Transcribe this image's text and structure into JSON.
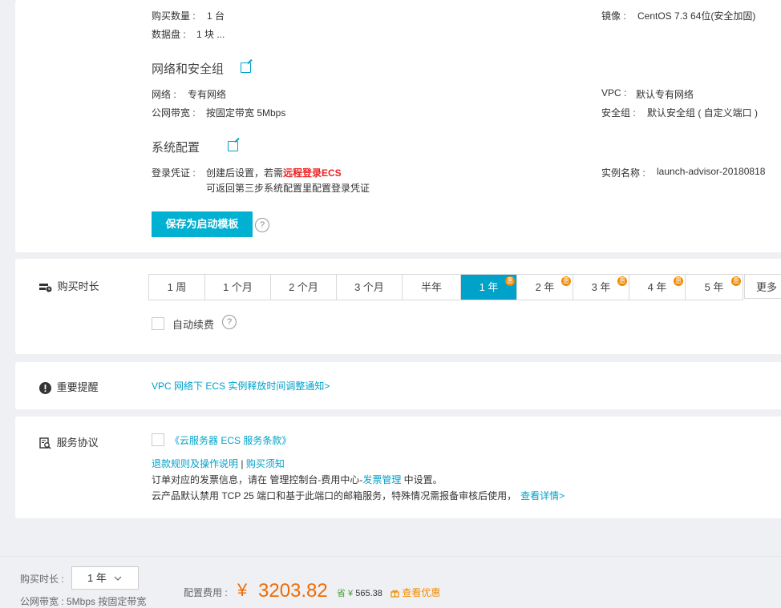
{
  "summary": {
    "purchase_qty_label": "购买数量 :",
    "purchase_qty_value": "1 台",
    "data_disk_label": "数据盘 :",
    "data_disk_value": "1 块 ...",
    "image_label": "镜像 :",
    "image_value": "CentOS 7.3 64位(安全加固)",
    "network_title": "网络和安全组",
    "network_label": "网络 :",
    "network_value": "专有网络",
    "bandwidth_label": "公网带宽 :",
    "bandwidth_value": "按固定带宽 5Mbps",
    "vpc_label": "VPC :",
    "vpc_value": "默认专有网络",
    "secgroup_label": "安全组 :",
    "secgroup_value": "默认安全组 ( 自定义端口 )",
    "system_title": "系统配置",
    "login_label": "登录凭证 :",
    "login_value_prefix": "创建后设置，若需",
    "login_value_link": "远程登录ECS",
    "login_value_line2": "可返回第三步系统配置里配置登录凭证",
    "instance_name_label": "实例名称 :",
    "instance_name_value": "launch-advisor-20180818",
    "save_template_label": "保存为启动模板",
    "help_glyph": "?"
  },
  "duration": {
    "label": "购买时长",
    "options": [
      {
        "label": "1 周",
        "discount": false,
        "active": false
      },
      {
        "label": "1 个月",
        "discount": false,
        "active": false
      },
      {
        "label": "2 个月",
        "discount": false,
        "active": false
      },
      {
        "label": "3 个月",
        "discount": false,
        "active": false
      },
      {
        "label": "半年",
        "discount": false,
        "active": false
      },
      {
        "label": "1 年",
        "discount": true,
        "active": true
      },
      {
        "label": "2 年",
        "discount": true,
        "active": false
      },
      {
        "label": "3 年",
        "discount": true,
        "active": false
      },
      {
        "label": "4 年",
        "discount": true,
        "active": false
      },
      {
        "label": "5 年",
        "discount": true,
        "active": false
      }
    ],
    "more_label": "更多",
    "auto_renew_label": "自动续费",
    "badge_glyph": "惠"
  },
  "notice": {
    "label": "重要提醒",
    "link": "VPC 网络下 ECS 实例释放时间调整通知>"
  },
  "agreement": {
    "label": "服务协议",
    "terms_link": "《云服务器 ECS 服务条款》",
    "refund_link": "退款规则及操作说明",
    "separator": "|",
    "purchase_notice_link": "购买须知",
    "invoice_prefix": "订单对应的发票信息，请在 管理控制台-费用中心-",
    "invoice_link": "发票管理",
    "invoice_suffix": " 中设置。",
    "tcp_text": "云产品默认禁用 TCP 25 端口和基于此端口的邮箱服务，特殊情况需报备审核后使用，",
    "tcp_link": "查看详情>"
  },
  "footer": {
    "duration_label": "购买时长 :",
    "duration_value": "1 年",
    "bandwidth_text": "公网带宽 : 5Mbps 按固定带宽",
    "fee_label": "配置费用 :",
    "currency": "¥",
    "price": "3203.82",
    "save_prefix": "省 ¥",
    "save_amount": "565.38",
    "coupon_link": "查看优惠"
  },
  "colors": {
    "accent": "#00a2ca",
    "price": "#f26a00",
    "discount_badge": "#f28b00",
    "link_red": "#e22222"
  }
}
